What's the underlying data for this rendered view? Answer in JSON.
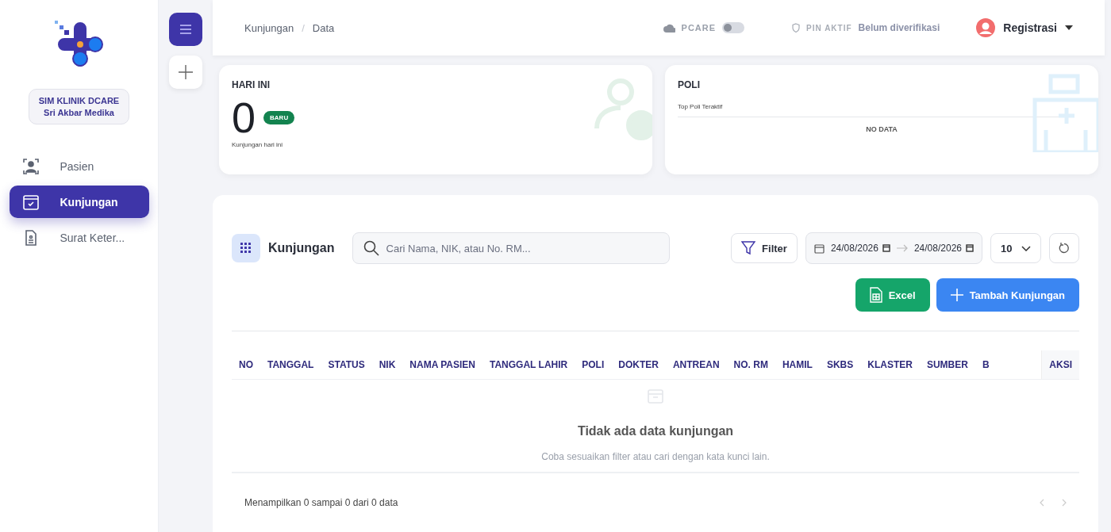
{
  "sidebar": {
    "clinic_name": "SIM KLINIK DCARE",
    "clinic_branch": "Sri Akbar Medika",
    "items": [
      {
        "label": "Pasien",
        "selected": false
      },
      {
        "label": "Kunjungan",
        "selected": true
      },
      {
        "label": "Surat Keter...",
        "selected": false
      }
    ]
  },
  "header": {
    "breadcrumb": [
      "Kunjungan",
      "/",
      "Data"
    ],
    "pcare": {
      "label": "PCARE",
      "on": false
    },
    "pin": {
      "label": "PIN AKTIF",
      "status": "Belum diverifikasi"
    },
    "user": "Registrasi"
  },
  "today_card": {
    "title": "HARI INI",
    "count": "0",
    "badge": "BARU",
    "caption": "Kunjungan hari ini"
  },
  "poli_card": {
    "title": "POLI",
    "subtitle": "Top Poli Teraktif",
    "empty": "NO DATA"
  },
  "panel": {
    "title": "Kunjungan",
    "search": {
      "placeholder": "Cari Nama, NIK, atau No. RM..."
    },
    "filter": "Filter",
    "date_from": "24/08/2026",
    "date_to": "24/08/2026",
    "page_size": "10",
    "excel": "Excel",
    "add": "Tambah Kunjungan",
    "columns": [
      "NO",
      "TANGGAL",
      "STATUS",
      "NIK",
      "NAMA PASIEN",
      "TANGGAL LAHIR",
      "POLI",
      "DOKTER",
      "ANTREAN",
      "NO. RM",
      "HAMIL",
      "SKBS",
      "KLASTER",
      "SUMBER",
      "B",
      "AKSI"
    ],
    "empty_title": "Tidak ada data kunjungan",
    "empty_hint": "Coba sesuaikan filter atau cari dengan kata kunci lain.",
    "footer": "Menampilkan 0 sampai 0 dari 0 data"
  }
}
